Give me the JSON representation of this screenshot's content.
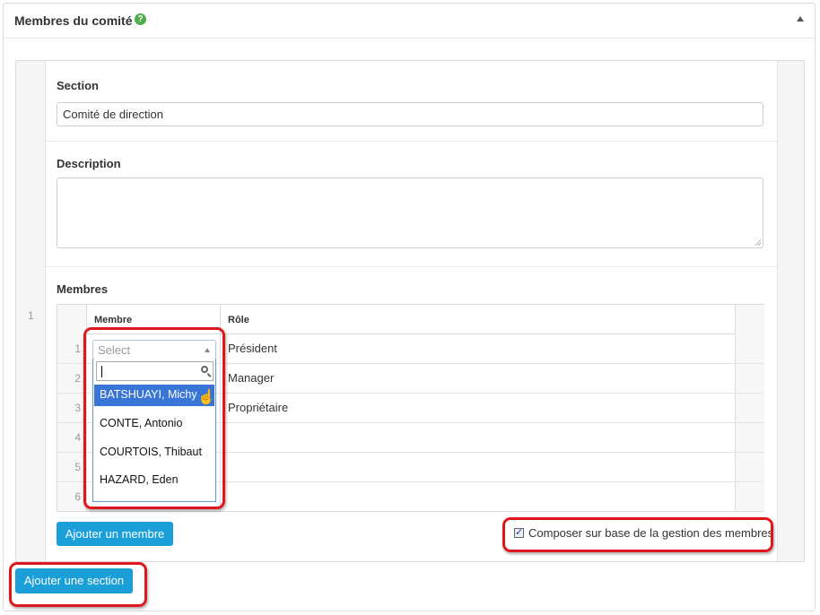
{
  "panel": {
    "title": "Membres du comité",
    "help_glyph": "?"
  },
  "section": {
    "row_number": "1",
    "label": "Section",
    "value": "Comité de direction",
    "description_label": "Description",
    "members_label": "Membres"
  },
  "members_table": {
    "headers": {
      "membre": "Membre",
      "role": "Rôle"
    },
    "rows": [
      {
        "num": "1",
        "role": "Président"
      },
      {
        "num": "2",
        "role": "Manager"
      },
      {
        "num": "3",
        "role": "Propriétaire"
      },
      {
        "num": "4",
        "role": ""
      },
      {
        "num": "5",
        "role": ""
      },
      {
        "num": "6",
        "role": ""
      }
    ],
    "select_placeholder": "Select",
    "dropdown_options": [
      "BATSHUAYI, Michy",
      "CONTE, Antonio",
      "COURTOIS, Thibaut",
      "HAZARD, Eden"
    ]
  },
  "buttons": {
    "add_member": "Ajouter un membre",
    "add_section": "Ajouter une section"
  },
  "checkbox": {
    "label": "Composer sur base de la gestion des membres",
    "checked": true
  },
  "colors": {
    "accent": "#1a9fd9",
    "highlight": "#3875d7",
    "annotation": "#e0161d",
    "help": "#4cae4c"
  }
}
